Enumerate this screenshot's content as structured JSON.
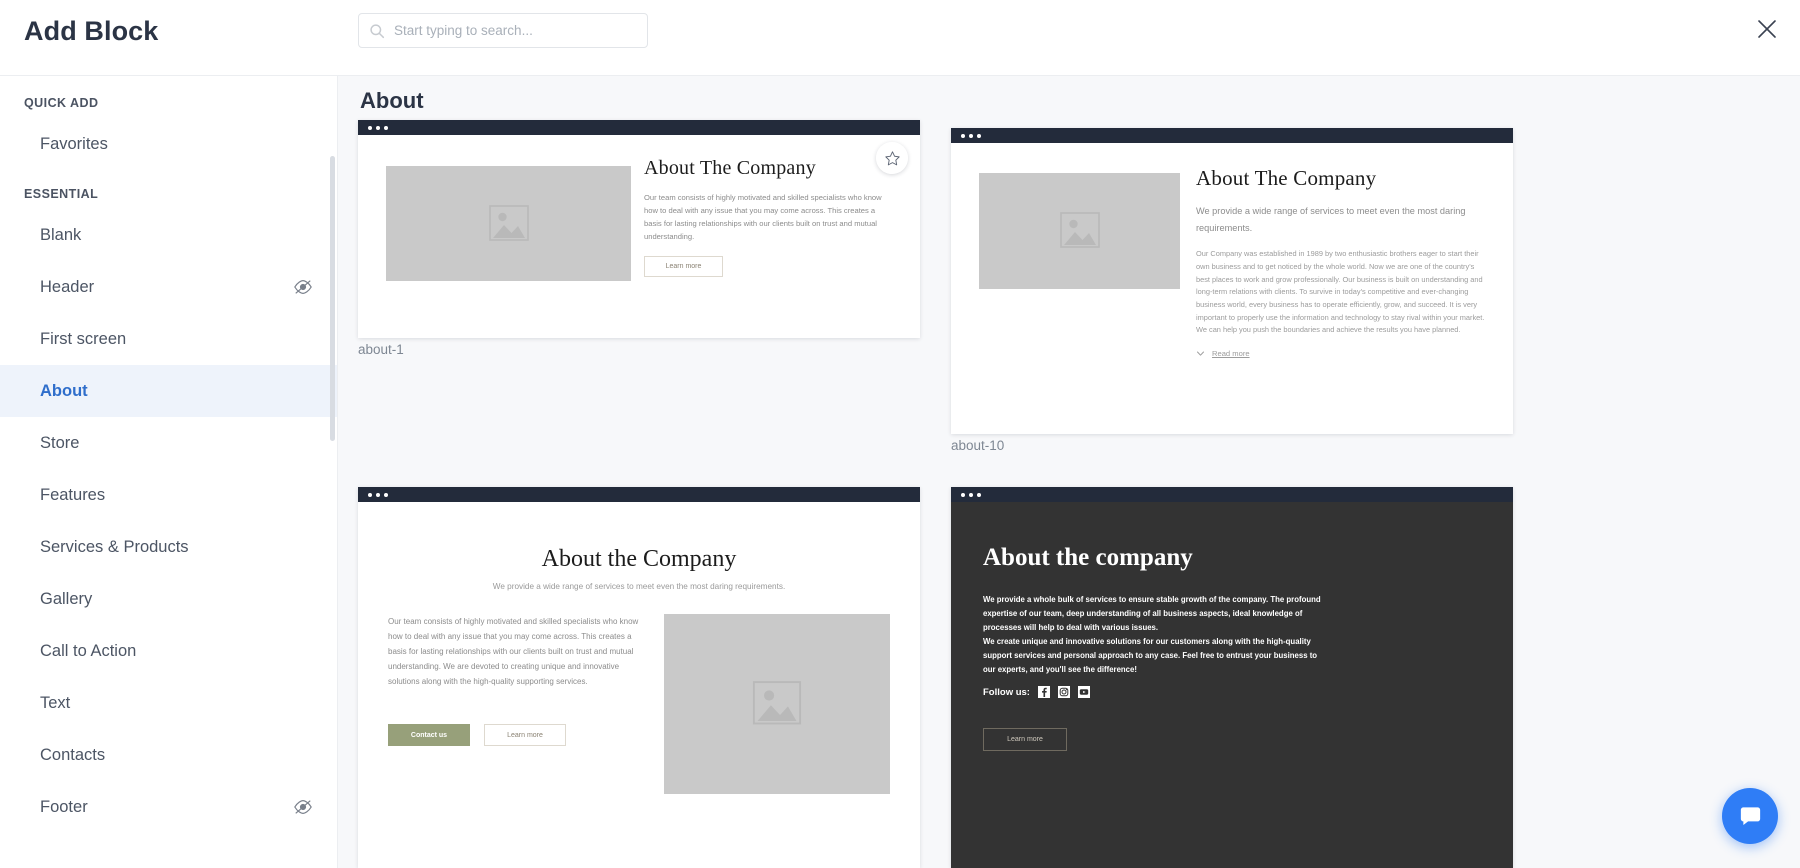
{
  "header": {
    "title": "Add Block",
    "search_placeholder": "Start typing to search...",
    "search_value": "",
    "close_label": "×"
  },
  "sidebar": {
    "groups": [
      {
        "label": "QUICK ADD",
        "items": [
          {
            "label": "Favorites",
            "active": false,
            "eye": false
          }
        ]
      },
      {
        "label": "ESSENTIAL",
        "items": [
          {
            "label": "Blank",
            "active": false,
            "eye": false
          },
          {
            "label": "Header",
            "active": false,
            "eye": true
          },
          {
            "label": "First screen",
            "active": false,
            "eye": false
          },
          {
            "label": "About",
            "active": true,
            "eye": false
          },
          {
            "label": "Store",
            "active": false,
            "eye": false
          },
          {
            "label": "Features",
            "active": false,
            "eye": false
          },
          {
            "label": "Services & Products",
            "active": false,
            "eye": false
          },
          {
            "label": "Gallery",
            "active": false,
            "eye": false
          },
          {
            "label": "Call to Action",
            "active": false,
            "eye": false
          },
          {
            "label": "Text",
            "active": false,
            "eye": false
          },
          {
            "label": "Contacts",
            "active": false,
            "eye": false
          },
          {
            "label": "Footer",
            "active": false,
            "eye": true
          }
        ]
      }
    ]
  },
  "main": {
    "section_title": "About",
    "cards": {
      "about_1": {
        "label": "about-1",
        "heading": "About The Company",
        "body": "Our team consists of highly motivated and skilled specialists who know how to deal with any issue that you may come across. This creates a basis for lasting relationships with our clients built on trust and mutual understanding.",
        "button": "Learn more"
      },
      "about_10": {
        "label": "about-10",
        "heading": "About The Company",
        "lead": "We provide a wide range of services to meet even the most daring requirements.",
        "body": "Our Company was established in 1989 by two enthusiastic brothers eager to start their own business and to get noticed by the whole world. Now we are one of the country's best places to work and grow professionally. Our business is built on understanding and long-term relations with clients. To survive in today's competitive and ever-changing business world, every business has to operate efficiently, grow, and succeed. It is very important to properly use the information and technology to stay rival within your market. We can help you push the boundaries and achieve the results you have planned.",
        "read_more": "Read more"
      },
      "about_light": {
        "heading": "About the Company",
        "lead": "We provide a wide range of services to meet even the most daring requirements.",
        "body": "Our team consists of highly motivated and skilled specialists who know how to deal with any issue that you may come across. This creates a basis for lasting relationships with our clients built on trust and mutual understanding. We are devoted to creating unique and innovative solutions along with the high-quality supporting services.",
        "primary_button": "Contact us",
        "secondary_button": "Learn more"
      },
      "about_dark": {
        "heading": "About the company",
        "body_1": "We provide a whole bulk of services to ensure stable growth of the company. The profound expertise of our team, deep understanding of all business aspects, ideal knowledge of processes will help to deal with various issues.",
        "body_2": "We create unique and innovative solutions for our customers along with the high-quality support services and personal approach to any case. Feel free to entrust your business to our experts, and you'll see the difference!",
        "follow_label": "Follow us:",
        "social": [
          "facebook-icon",
          "instagram-icon",
          "youtube-icon"
        ],
        "button": "Learn more"
      }
    }
  },
  "colors": {
    "accent": "#2f6ecb",
    "chat_fab": "#2f7df6",
    "dark_card": "#333333",
    "browser_bar": "#232b3b",
    "primary_button": "#97a07a",
    "placeholder_image": "#c9c9c9"
  },
  "icons": {
    "search": "search-icon",
    "close": "close-icon",
    "eye": "eye-hidden-icon",
    "star": "star-icon",
    "chevron_down": "chevron-down-icon",
    "chat": "chat-bubble-icon"
  }
}
